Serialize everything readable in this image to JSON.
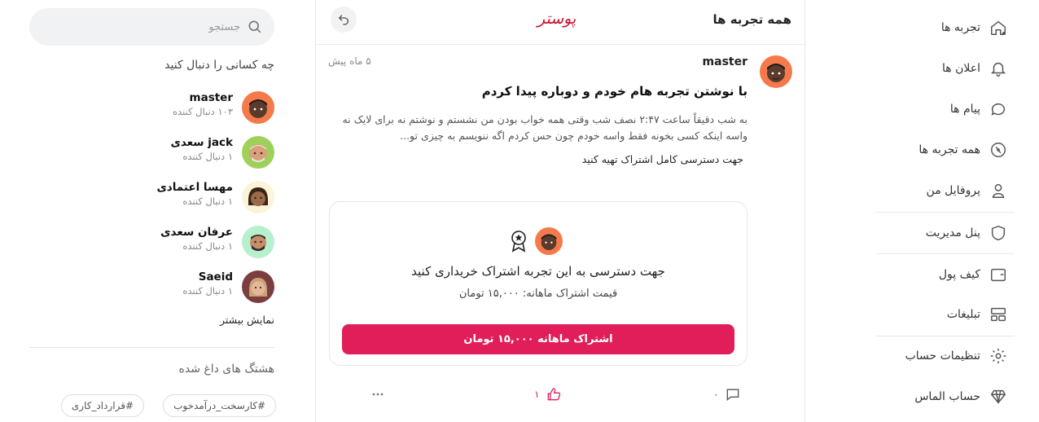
{
  "sidebar": {
    "items": [
      {
        "label": "تجربه ها",
        "icon": "home-icon"
      },
      {
        "label": "اعلان ها",
        "icon": "bell-icon"
      },
      {
        "label": "پیام ها",
        "icon": "chat-icon"
      },
      {
        "label": "همه تجربه ها",
        "icon": "compass-icon"
      },
      {
        "label": "پروفایل من",
        "icon": "user-icon"
      },
      {
        "label": "پنل مدیریت",
        "icon": "shield-icon"
      },
      {
        "label": "کیف پول",
        "icon": "wallet-icon"
      },
      {
        "label": "تبلیغات",
        "icon": "ads-grid-icon"
      },
      {
        "label": "تنظیمات حساب",
        "icon": "gear-icon"
      },
      {
        "label": "حساب الماس",
        "icon": "diamond-icon"
      }
    ]
  },
  "header": {
    "title": "همه تجربه ها",
    "brand": "پوستر"
  },
  "post": {
    "author": "master",
    "time": "۵ ماه پیش",
    "title": "با نوشتن تجربه هام خودم و دوباره پیدا کردم",
    "body": "به شب دقیقاً ساعت ۲:۴۷ نصف شب وقتی همه خواب بودن من نشستم و نوشتم نه برای لایک نه واسه اینکه کسی بخونه فقط واسه خودم چون حس کردم اگه ننویسم به چیزی تو...",
    "note": "جهت دسترسی کامل اشتراک تهیه کنید",
    "card": {
      "title": "جهت دسترسی به این تجربه اشتراک خریداری کنید",
      "price": "قیمت اشتراک ماهانه: ۱۵,۰۰۰ تومان",
      "button": "اشتراک ماهانه ۱۵,۰۰۰ تومان"
    },
    "comments": "۰",
    "likes": "۱"
  },
  "search": {
    "placeholder": "جستجو"
  },
  "who_to_follow": {
    "title": "چه کسانی را دنبال کنید",
    "users": [
      {
        "name": "master",
        "followers": "۱۰۳ دنبال کننده"
      },
      {
        "name": "jack سعدی",
        "followers": "۱ دنبال کننده"
      },
      {
        "name": "مهسا اعتمادی",
        "followers": "۱ دنبال کننده"
      },
      {
        "name": "عرفان سعدی",
        "followers": "۱ دنبال کننده"
      },
      {
        "name": "Saeid",
        "followers": "۱ دنبال کننده"
      }
    ],
    "show_more": "نمایش بیشتر"
  },
  "hashtags": {
    "title": "هشتگ های داغ شده",
    "tags": [
      "#کارسخت_درآمدخوب",
      "#قرارداد_کاری"
    ]
  },
  "colors": {
    "accent": "#e11d5a",
    "brand": "#c8102e"
  }
}
